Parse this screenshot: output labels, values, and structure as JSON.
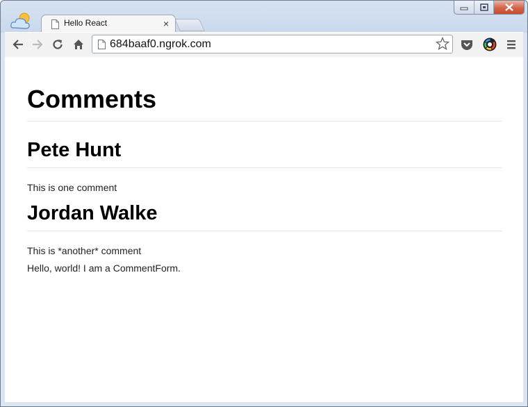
{
  "browser": {
    "tab_title": "Hello React",
    "tab_close": "×",
    "url": "684baaf0.ngrok.com"
  },
  "page": {
    "heading": "Comments",
    "comments": [
      {
        "author": "Pete Hunt",
        "text": "This is one comment"
      },
      {
        "author": "Jordan Walke",
        "text": "This is *another* comment"
      }
    ],
    "form_text": "Hello, world! I am a CommentForm."
  },
  "colors": {
    "close_button": "#d46349",
    "frame": "#c9d8ec"
  }
}
